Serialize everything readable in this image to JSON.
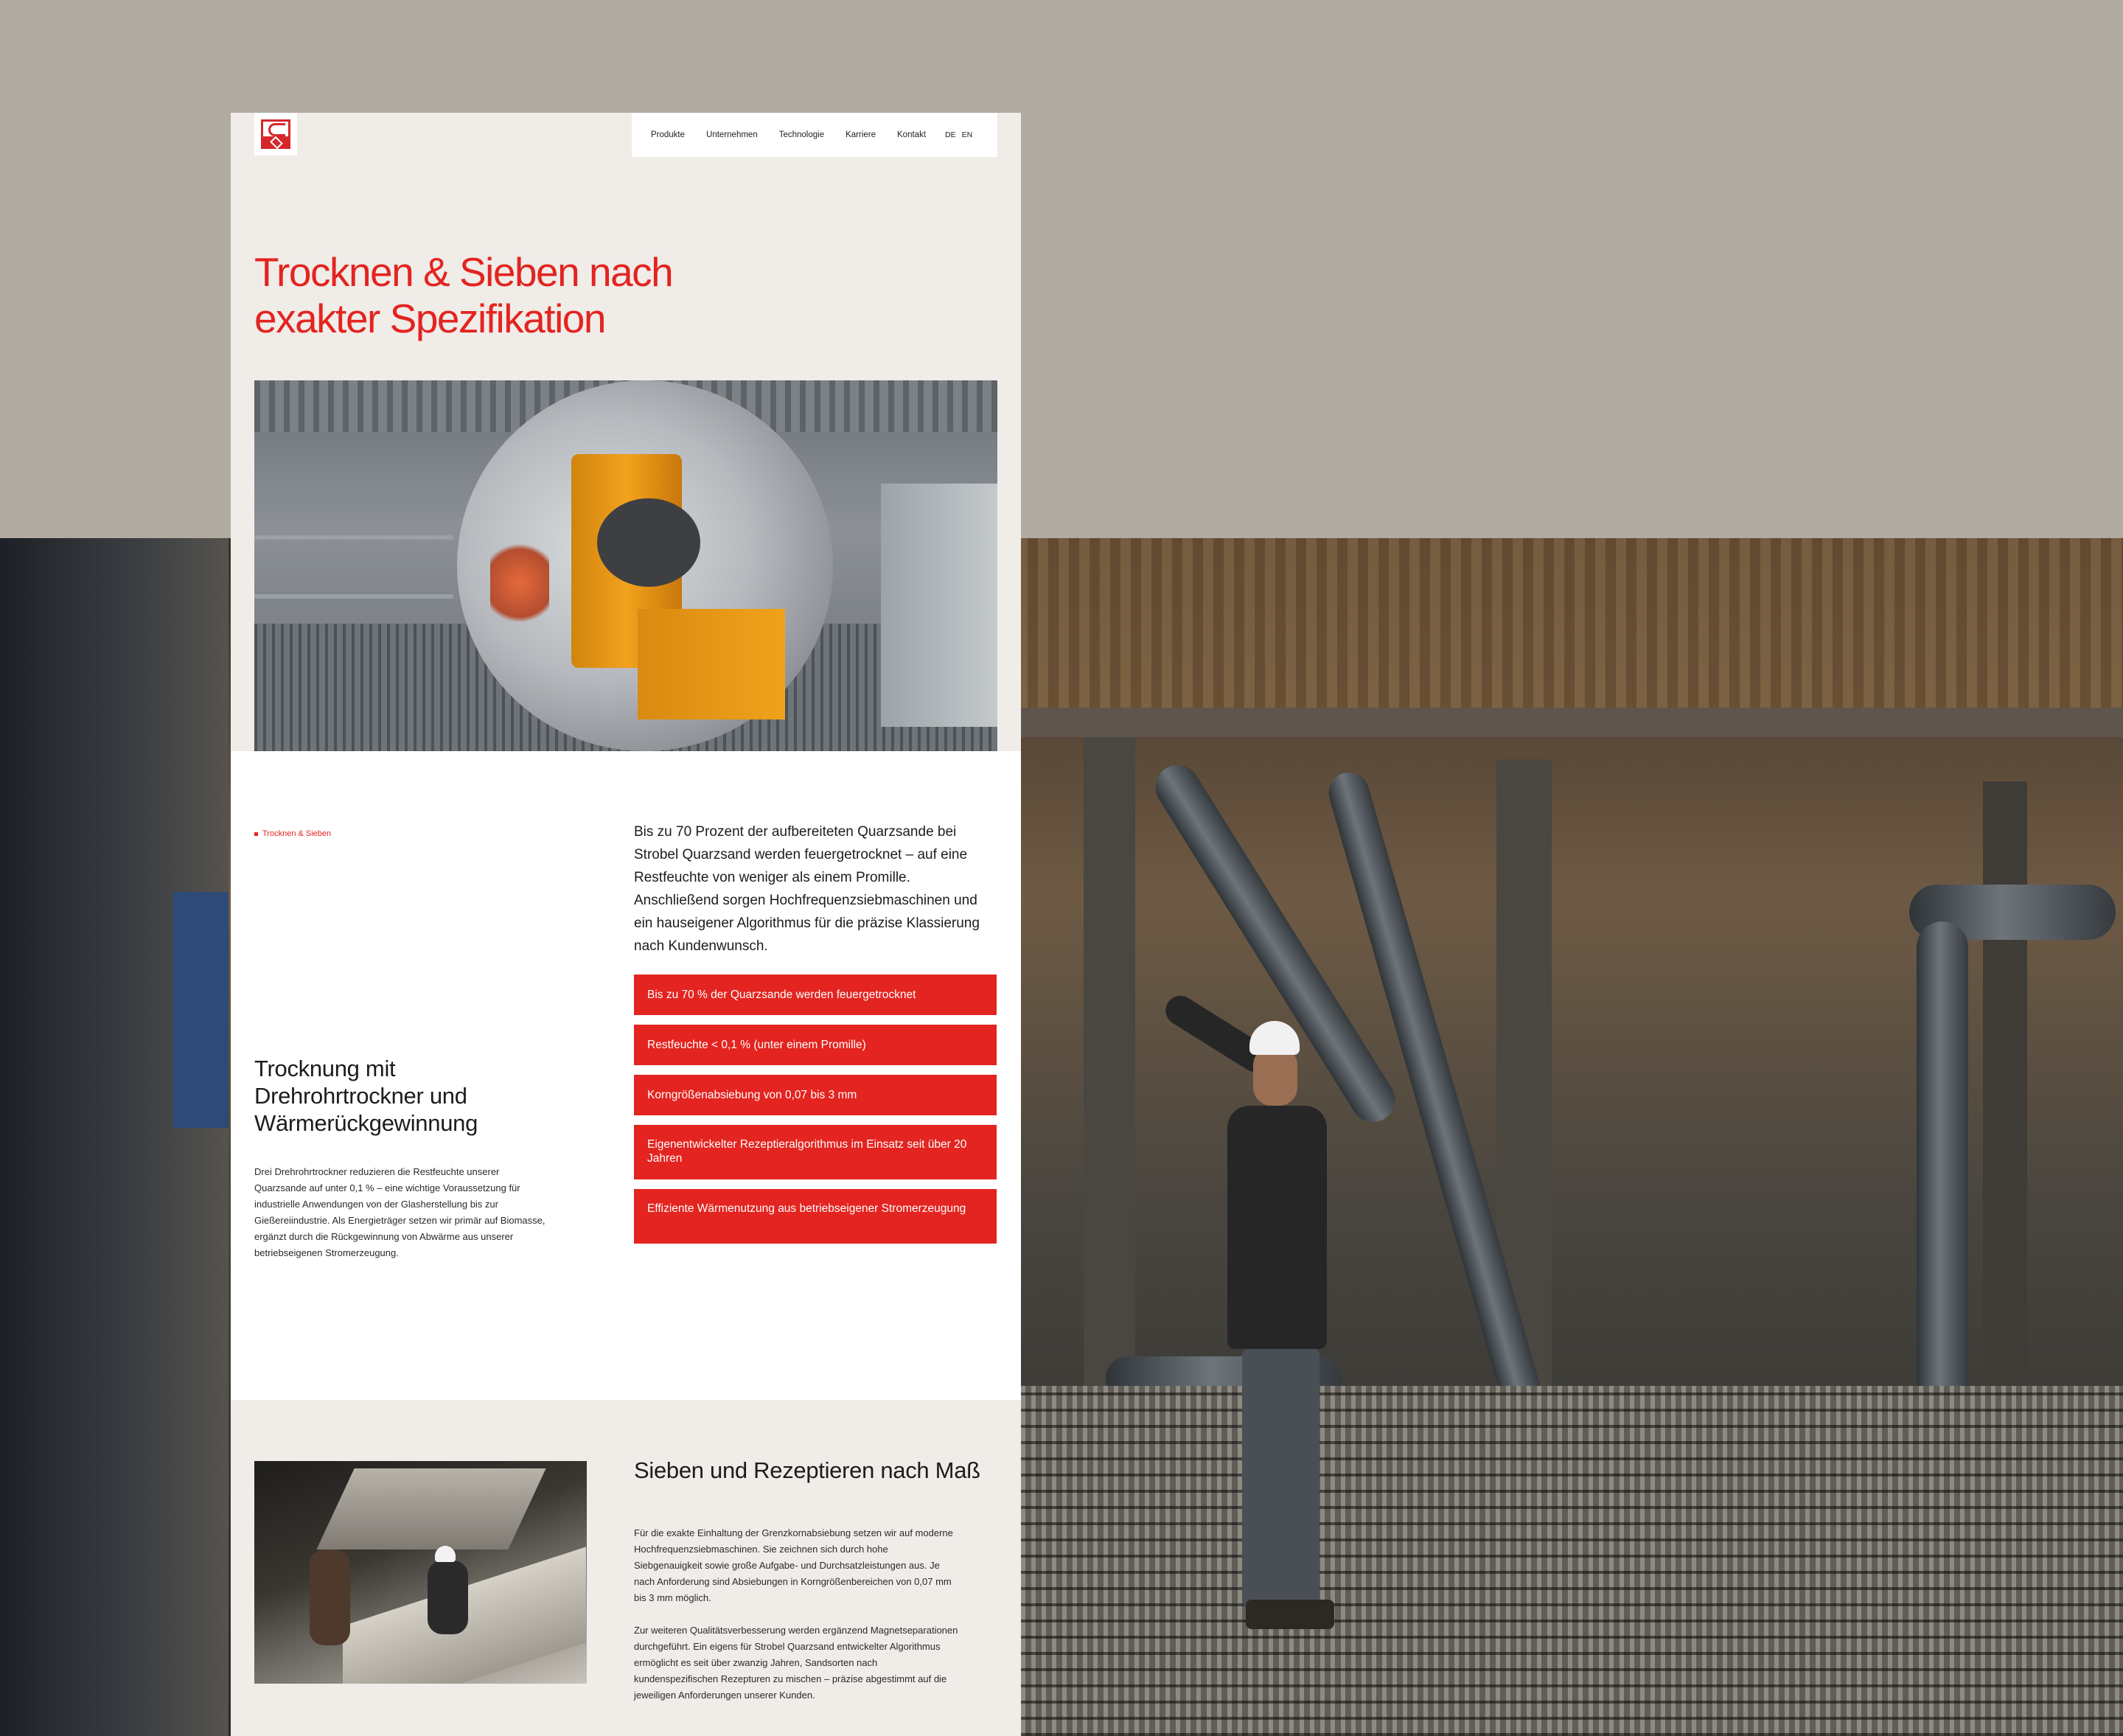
{
  "nav": {
    "items": [
      "Produkte",
      "Unternehmen",
      "Technologie",
      "Karriere",
      "Kontakt"
    ],
    "lang": [
      "DE",
      "EN"
    ]
  },
  "hero": {
    "title": "Trocknen & Sieben nach exakter Spezifikation"
  },
  "breadcrumb": "Trocknen & Sieben",
  "intro": "Bis zu 70 Prozent der aufbereiteten Quarzsande bei Strobel Quarzsand werden feuergetrocknet – auf eine Restfeuchte von weniger als einem Promille. Anschließend sorgen Hochfrequenzsiebmaschinen und ein hauseigener Algorithmus für die präzise Klassierung nach Kundenwunsch.",
  "drying": {
    "title": "Trocknung mit Drehrohrtrockner und Wärmerückgewinnung",
    "body": "Drei Drehrohrtrockner reduzieren die Restfeuchte unserer Quarzsande auf unter 0,1 % – eine wichtige Voraussetzung für industrielle Anwendungen von der Glasherstellung bis zur Gießereiindustrie. Als Energieträger setzen wir primär auf Biomasse, ergänzt durch die Rückgewinnung von Abwärme aus unserer betriebseigenen Stromerzeugung.",
    "features": [
      "Bis zu 70 % der Quarzsande werden feuergetrocknet",
      "Restfeuchte < 0,1 % (unter einem Promille)",
      "Korngrößenabsiebung von 0,07 bis 3 mm",
      "Eigenentwickelter Rezeptieralgorithmus im Einsatz seit über 20 Jahren",
      "Effiziente Wärmenutzung aus betriebseigener Stromerzeugung"
    ]
  },
  "sieving": {
    "title": "Sieben und Rezeptieren nach Maß",
    "p1": "Für die exakte Einhaltung der Grenzkornabsiebung setzen wir auf moderne Hochfrequenzsiebmaschinen. Sie zeichnen sich durch hohe Siebgenauigkeit sowie große Aufgabe- und Durchsatzleistungen aus. Je nach Anforderung sind Absiebungen in Korngrößenbereichen von 0,07 mm bis 3 mm möglich.",
    "p2": "Zur weiteren Qualitätsverbesserung werden ergänzend Magnetseparationen durchgeführt. Ein eigens für Strobel Quarzsand entwickelter Algorithmus ermöglicht es seit über zwanzig Jahren, Sandsorten nach kundenspezifischen Rezepturen zu mischen – präzise abgestimmt auf die jeweiligen Anforderungen unserer Kunden."
  },
  "colors": {
    "accent": "#e32420",
    "page_bg": "#f0ece8",
    "backdrop": "#b2aba1"
  }
}
